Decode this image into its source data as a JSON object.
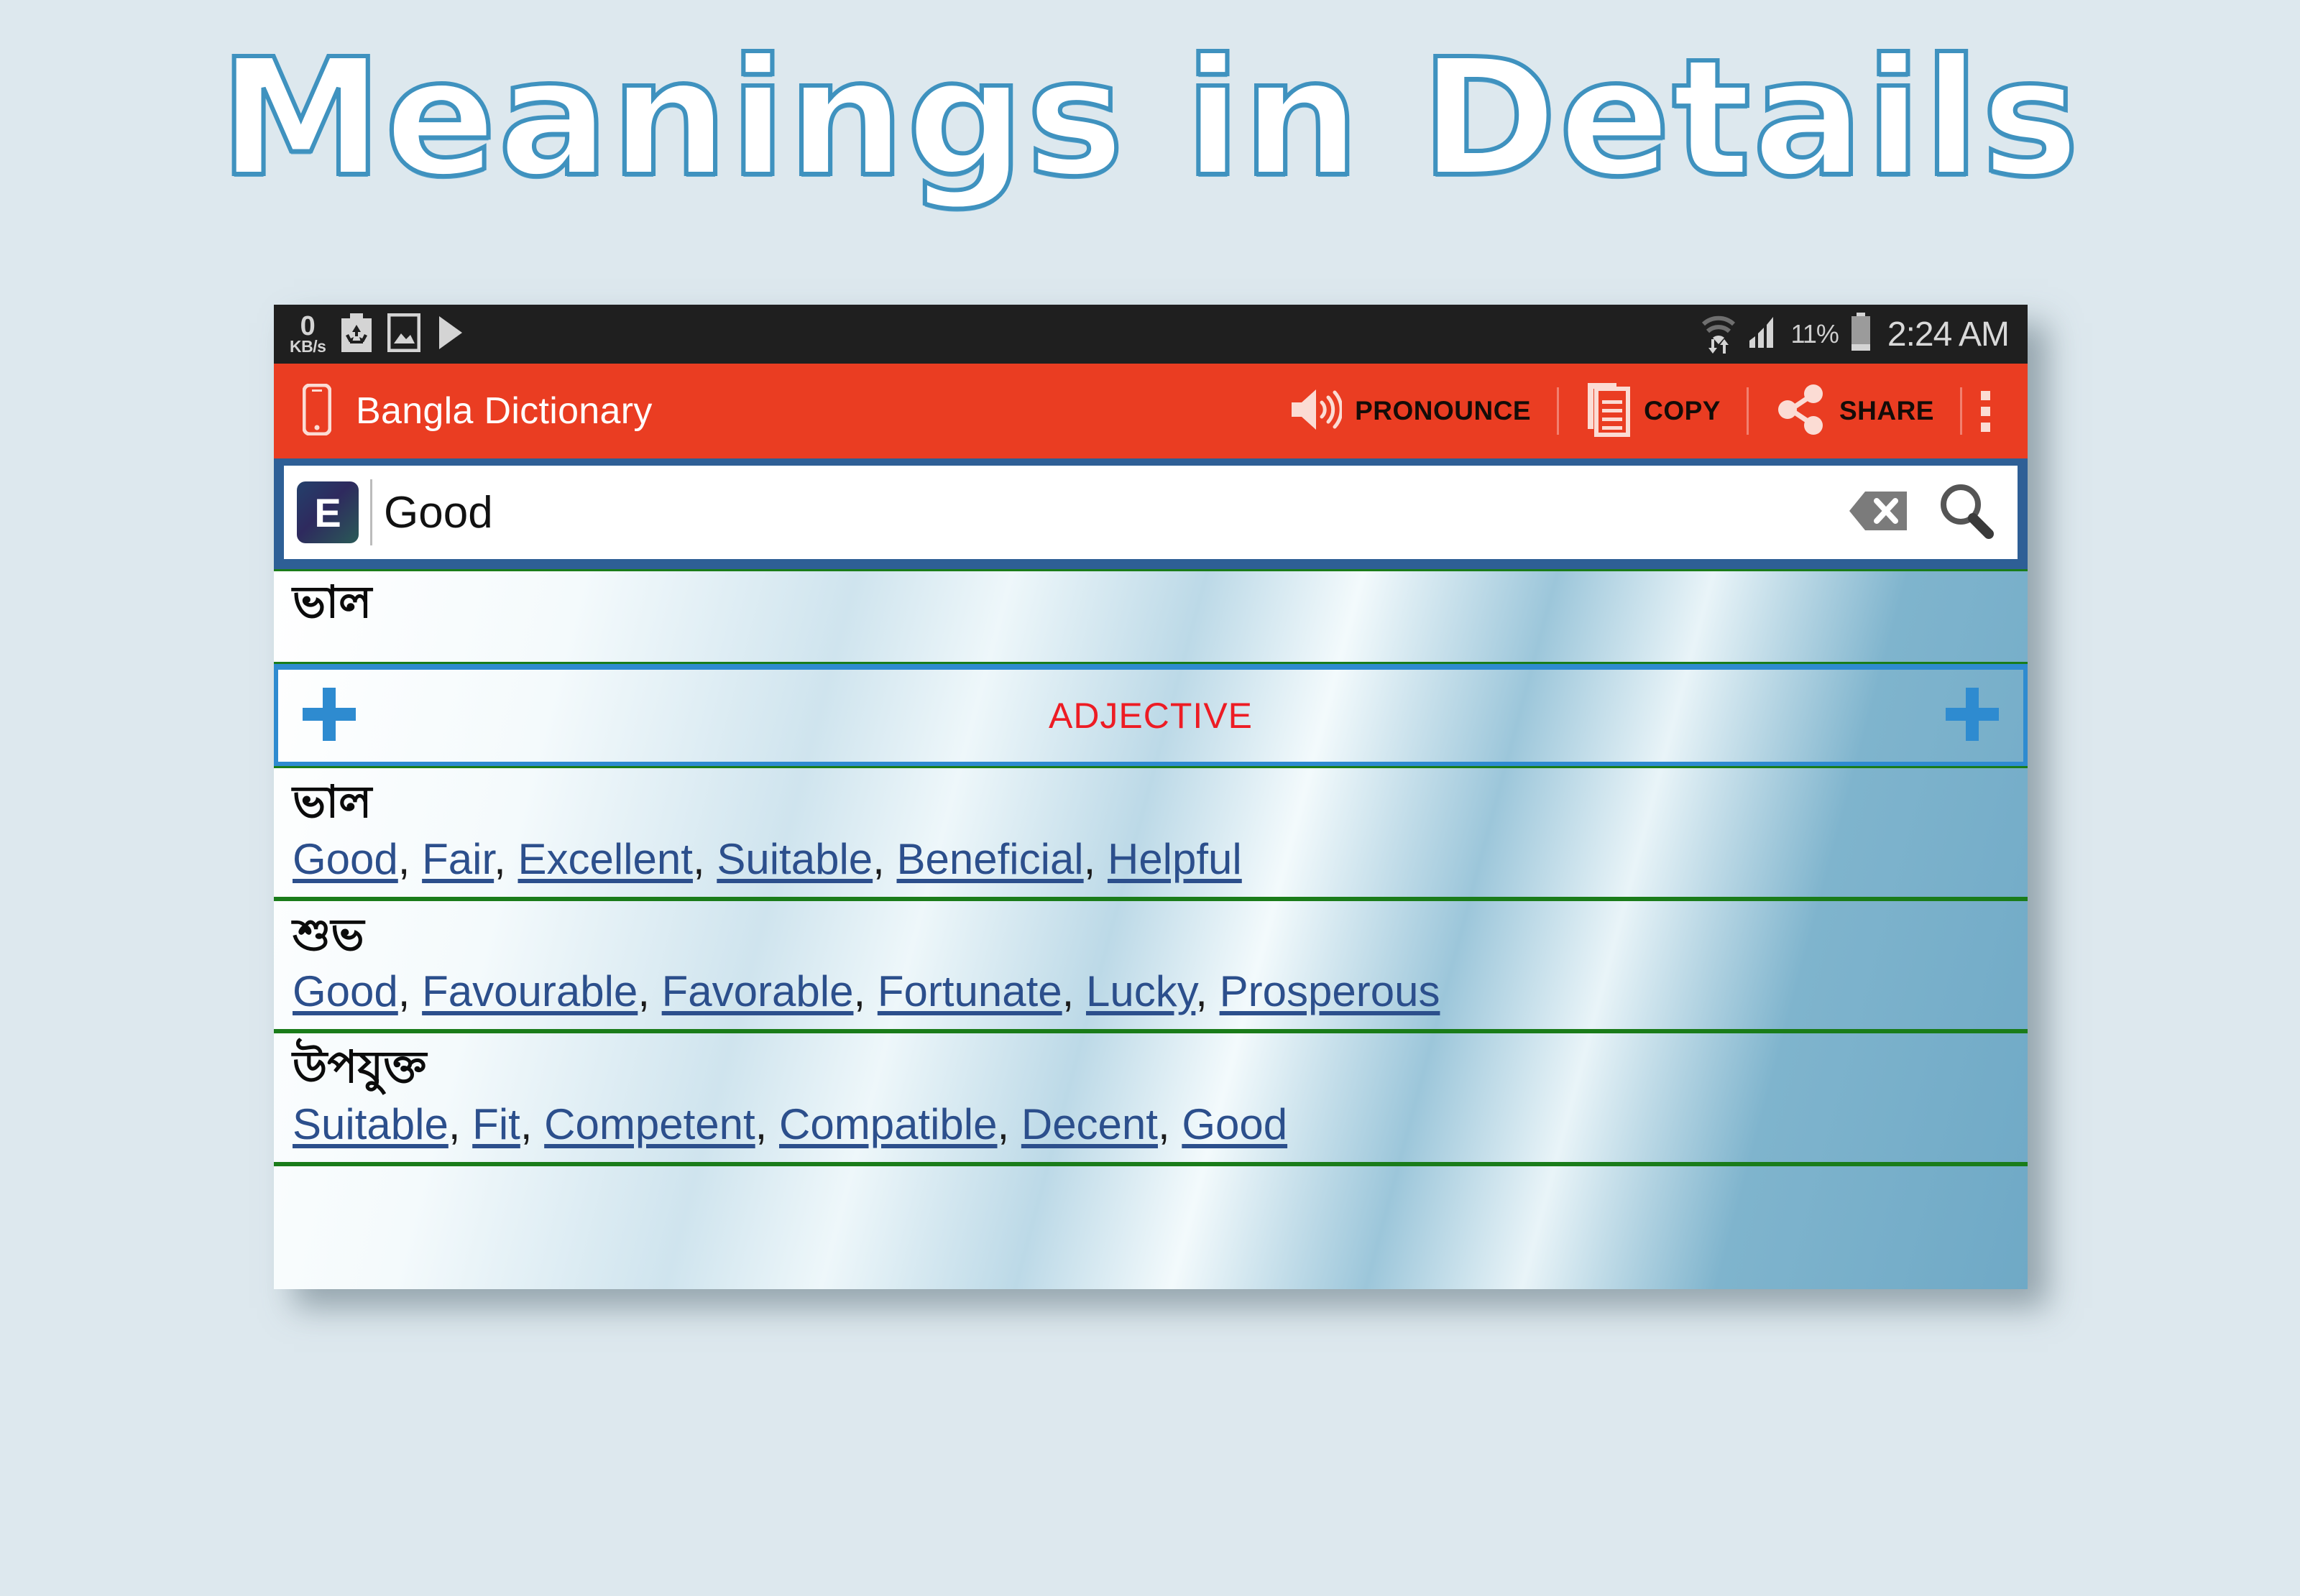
{
  "banner": {
    "title": "Meanings in Details"
  },
  "status_bar": {
    "data_rate_value": "0",
    "data_rate_unit": "KB/s",
    "icons": [
      "recycle-icon",
      "screenshot-icon",
      "play-icon",
      "wifi-icon",
      "signal-icon"
    ],
    "battery_percent": "11%",
    "time": "2:24 AM"
  },
  "action_bar": {
    "app_title": "Bangla Dictionary",
    "phone_icon": "phone-icon",
    "actions": [
      {
        "label": "PRONOUNCE",
        "icon": "speaker-icon"
      },
      {
        "label": "COPY",
        "icon": "copy-icon"
      },
      {
        "label": "SHARE",
        "icon": "share-icon"
      }
    ],
    "overflow": "overflow-menu-icon",
    "bar_color": "#ea3d22"
  },
  "search": {
    "language_badge": "E",
    "query": "Good",
    "placeholder": "Good",
    "clear_icon": "backspace-clear-icon",
    "search_icon": "search-icon",
    "frame_color": "#2e5f96"
  },
  "results": {
    "headword": "ভাল",
    "part_of_speech": "ADJECTIVE",
    "pos_color": "#ed1c24",
    "add_left_icon": "plus-icon",
    "add_right_icon": "plus-icon",
    "entries": [
      {
        "bengali": "ভাল",
        "synonyms": [
          "Good",
          "Fair",
          "Excellent",
          "Suitable",
          "Beneficial",
          "Helpful"
        ]
      },
      {
        "bengali": "শুভ",
        "synonyms": [
          "Good",
          "Favourable",
          "Favorable",
          "Fortunate",
          "Lucky",
          "Prosperous"
        ]
      },
      {
        "bengali": "উপযুক্ত",
        "synonyms": [
          "Suitable",
          "Fit",
          "Competent",
          "Compatible",
          "Decent",
          "Good"
        ]
      }
    ]
  }
}
